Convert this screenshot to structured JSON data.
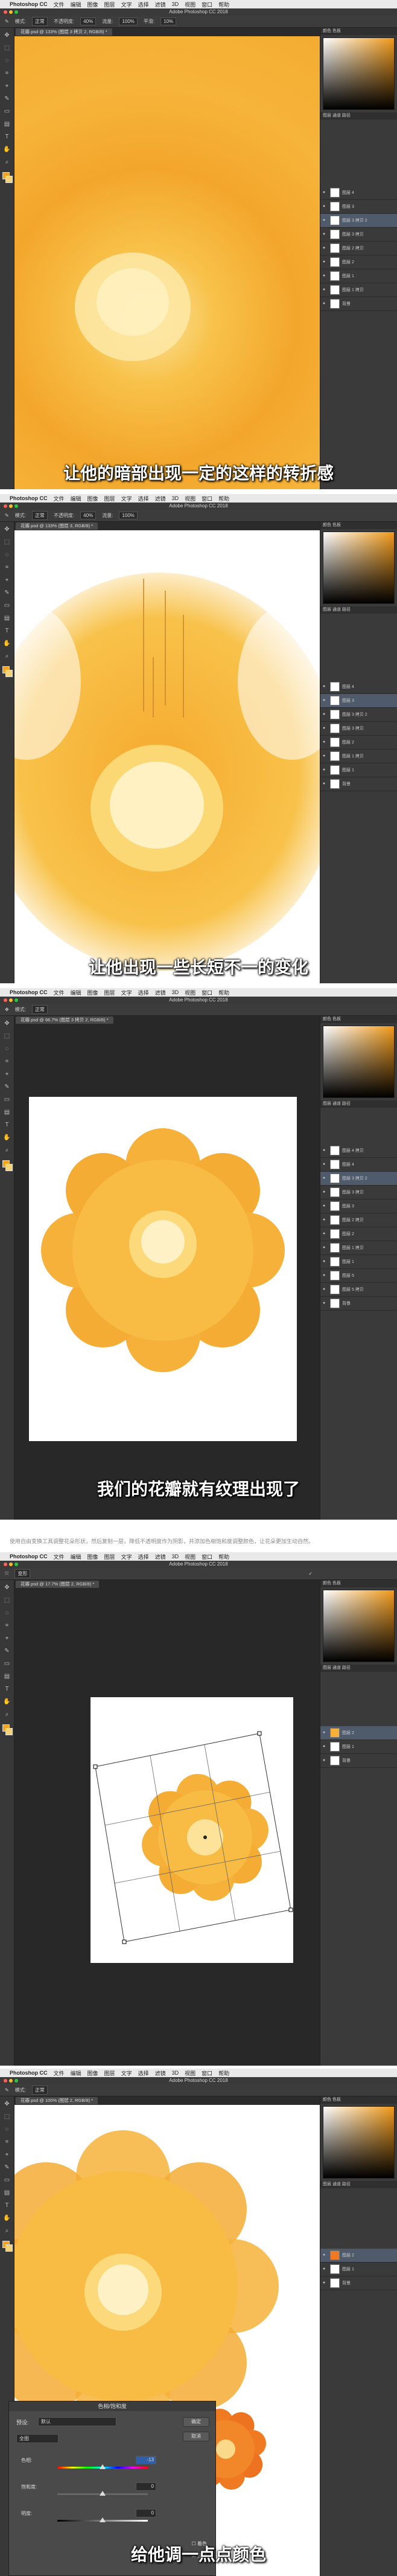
{
  "app": {
    "name": "Photoshop CC",
    "window_title": "Adobe Photoshop CC 2018",
    "menus": [
      "文件",
      "编辑",
      "图像",
      "图层",
      "文字",
      "选择",
      "滤镜",
      "3D",
      "视图",
      "窗口",
      "帮助"
    ]
  },
  "options": {
    "mode_label": "模式:",
    "mode_value": "正常",
    "opacity_label": "不透明度:",
    "opacity_value": "40%",
    "flow_label": "流量:",
    "flow_value": "100%",
    "smooth_label": "平滑:",
    "smooth_value": "10%"
  },
  "frames": [
    {
      "doc_tab": "花瓣.psd @ 133% (图层 3 拷贝 2, RGB/8) *",
      "subtitle": "让他的暗部出现一定的这样的转折感",
      "layers": [
        "图层 4",
        "图层 3",
        "图层 3 拷贝 2",
        "图层 3 拷贝",
        "图层 2 拷贝",
        "图层 2",
        "图层 1",
        "图层 1 拷贝",
        "背景"
      ]
    },
    {
      "doc_tab": "花瓣.psd @ 133% (图层 3, RGB/8) *",
      "subtitle": "让他出现一些长短不一的变化",
      "layers": [
        "图层 4",
        "图层 3",
        "图层 3 拷贝 2",
        "图层 3 拷贝",
        "图层 2",
        "图层 1 拷贝",
        "图层 1",
        "背景"
      ]
    },
    {
      "doc_tab": "花瓣.psd @ 66.7% (图层 3 拷贝 2, RGB/8) *",
      "subtitle": "我们的花瓣就有纹理出现了",
      "layers": [
        "图层 4 拷贝",
        "图层 4",
        "图层 3 拷贝 2",
        "图层 3 拷贝",
        "图层 3",
        "图层 2 拷贝",
        "图层 2",
        "图层 1 拷贝",
        "图层 1",
        "图层 5",
        "图层 5 拷贝",
        "背景"
      ]
    },
    {
      "doc_tab": "花瓣.psd @ 17.7% (图层 2, RGB/8) *",
      "subtitle": "",
      "layers": [
        "图层 2",
        "图层 1",
        "背景"
      ]
    },
    {
      "doc_tab": "花瓣.psd @ 100% (图层 2, RGB/8) *",
      "subtitle": "给他调一点点颜色",
      "layers": [
        "图层 2",
        "图层 1",
        "背景"
      ]
    }
  ],
  "caption": "使用自由变换工具调整花朵形状，然后复制一层，降低不透明度作为阴影，并添加色相饱和度调整颜色，让花朵更加生动自然。",
  "hue_saturation": {
    "title": "色相/饱和度",
    "preset_label": "预设:",
    "preset_value": "默认",
    "channel_value": "全图",
    "hue_label": "色相:",
    "hue_value": "-13",
    "saturation_label": "饱和度:",
    "saturation_value": "0",
    "lightness_label": "明度:",
    "lightness_value": "0",
    "ok_label": "确定",
    "cancel_label": "取消",
    "colorize_label": "着色",
    "preview_label": "预览"
  },
  "colors": {
    "accent_orange": "#f19a1a",
    "petal_yellow": "#f8c24a",
    "center_cream": "#fbe6a4",
    "ui_dark": "#2b2b2b",
    "layer_highlight": "#4f5b6b"
  }
}
